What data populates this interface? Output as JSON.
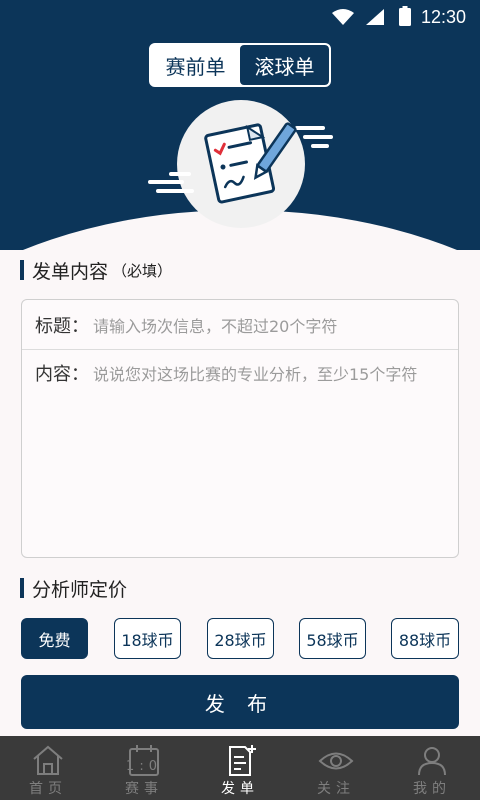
{
  "status_bar": {
    "time": "12:30"
  },
  "tabs": [
    {
      "label": "赛前单",
      "active": false
    },
    {
      "label": "滚球单",
      "active": true
    }
  ],
  "content_section": {
    "title": "发单内容",
    "note": "（必填）"
  },
  "form": {
    "title_label": "标题：",
    "title_placeholder": "请输入场次信息，不超过20个字符",
    "content_label": "内容：",
    "content_placeholder": "说说您对这场比赛的专业分析，至少15个字符"
  },
  "pricing_section": {
    "title": "分析师定价"
  },
  "prices": [
    {
      "label": "免费",
      "selected": true
    },
    {
      "label": "18球币",
      "selected": false
    },
    {
      "label": "28球币",
      "selected": false
    },
    {
      "label": "58球币",
      "selected": false
    },
    {
      "label": "88球币",
      "selected": false
    }
  ],
  "submit_label": "发 布",
  "nav": [
    {
      "label": "首页",
      "icon": "home-icon",
      "active": false
    },
    {
      "label": "赛事",
      "icon": "scoreboard-icon",
      "active": false,
      "icon_text": "1:0"
    },
    {
      "label": "发单",
      "icon": "post-icon",
      "active": true
    },
    {
      "label": "关注",
      "icon": "eye-icon",
      "active": false
    },
    {
      "label": "我的",
      "icon": "user-icon",
      "active": false
    }
  ],
  "colors": {
    "primary": "#0c3559",
    "background": "#fbf7f8",
    "nav_bg": "#3a3a3a"
  }
}
